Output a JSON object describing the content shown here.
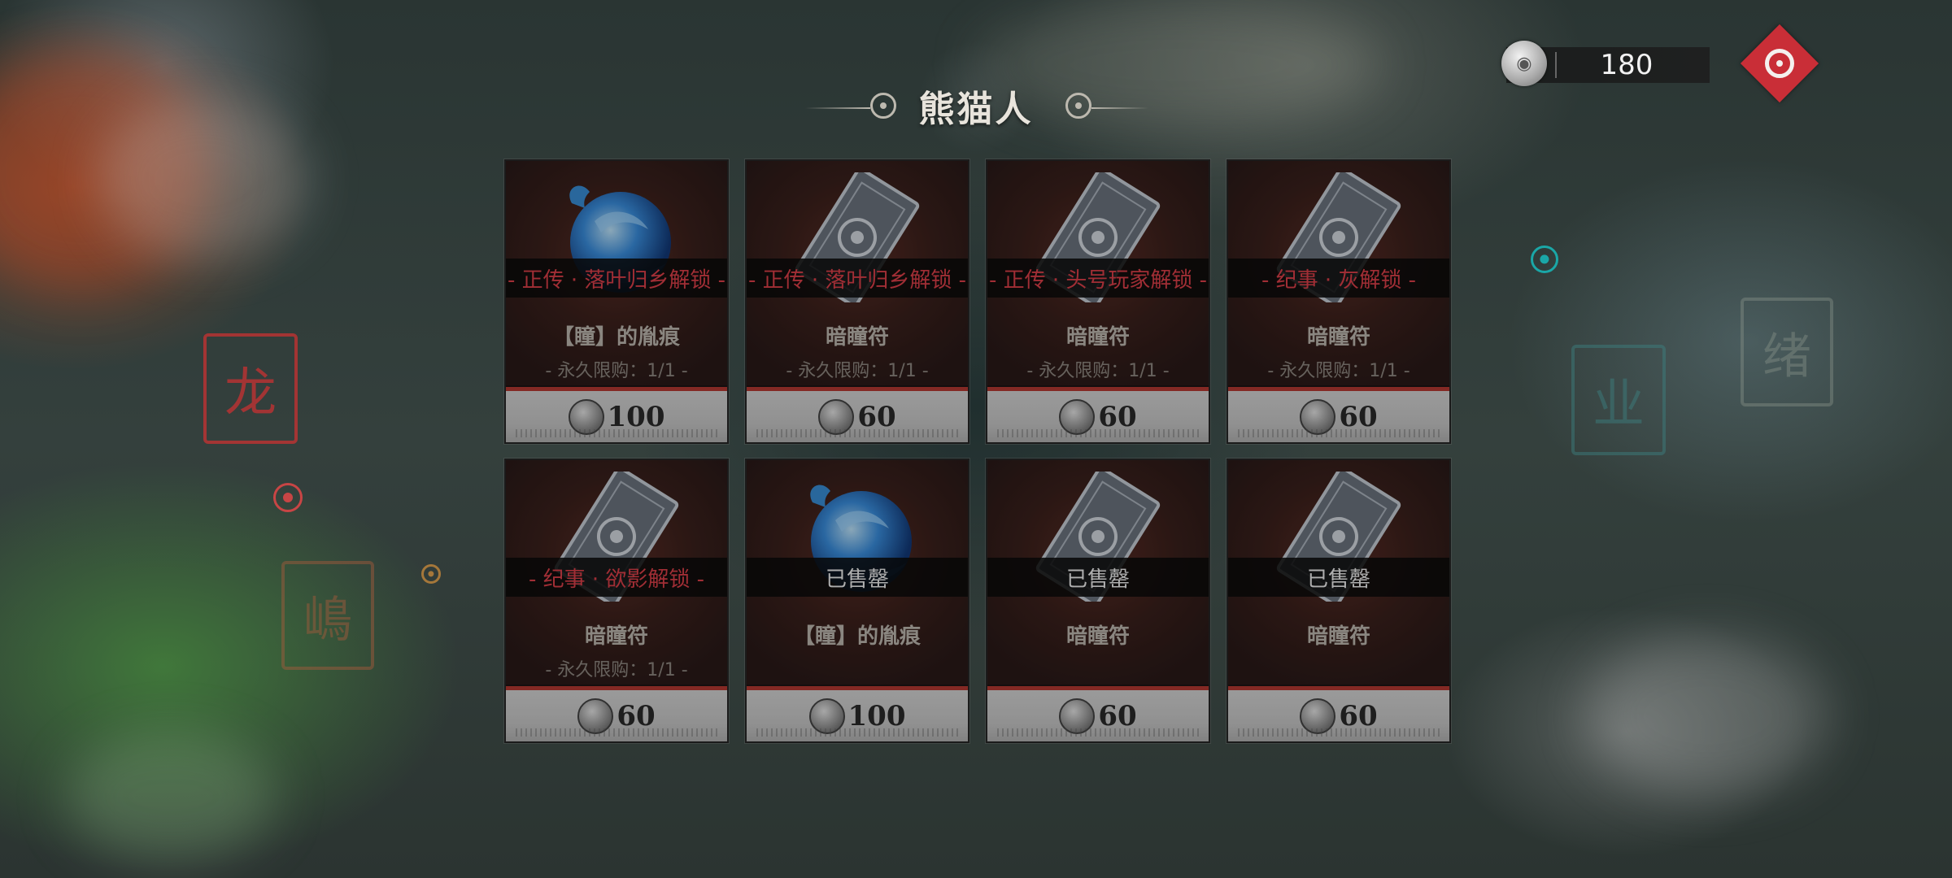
{
  "header": {
    "title": "熊猫人"
  },
  "currency": {
    "icon": "silver-coin-icon",
    "amount": "180"
  },
  "menu": {
    "icon": "red-diamond-eye-icon",
    "color": "#c92e37"
  },
  "colors": {
    "locked_text": "#e0404a",
    "price_bar_accent": "#b83a33"
  },
  "shop_items": [
    {
      "name": "【瞳】的胤痕",
      "icon": "blue-orb-icon",
      "banner": "- 正传 · 落叶归乡解锁 -",
      "status": "locked",
      "limit": "- 永久限购：1/1 -",
      "price": "100"
    },
    {
      "name": "暗瞳符",
      "icon": "talisman-card-icon",
      "banner": "- 正传 · 落叶归乡解锁 -",
      "status": "locked",
      "limit": "- 永久限购：1/1 -",
      "price": "60"
    },
    {
      "name": "暗瞳符",
      "icon": "talisman-card-icon",
      "banner": "- 正传 · 头号玩家解锁 -",
      "status": "locked",
      "limit": "- 永久限购：1/1 -",
      "price": "60"
    },
    {
      "name": "暗瞳符",
      "icon": "talisman-card-icon",
      "banner": "- 纪事 · 灰解锁 -",
      "status": "locked",
      "limit": "- 永久限购：1/1 -",
      "price": "60"
    },
    {
      "name": "暗瞳符",
      "icon": "talisman-card-icon",
      "banner": "- 纪事 · 欲影解锁 -",
      "status": "locked",
      "limit": "- 永久限购：1/1 -",
      "price": "60"
    },
    {
      "name": "【瞳】的胤痕",
      "icon": "blue-orb-icon",
      "banner": "已售罄",
      "status": "sold",
      "limit": "",
      "price": "100"
    },
    {
      "name": "暗瞳符",
      "icon": "talisman-card-icon",
      "banner": "已售罄",
      "status": "sold",
      "limit": "",
      "price": "60"
    },
    {
      "name": "暗瞳符",
      "icon": "talisman-card-icon",
      "banner": "已售罄",
      "status": "sold",
      "limit": "",
      "price": "60"
    }
  ]
}
